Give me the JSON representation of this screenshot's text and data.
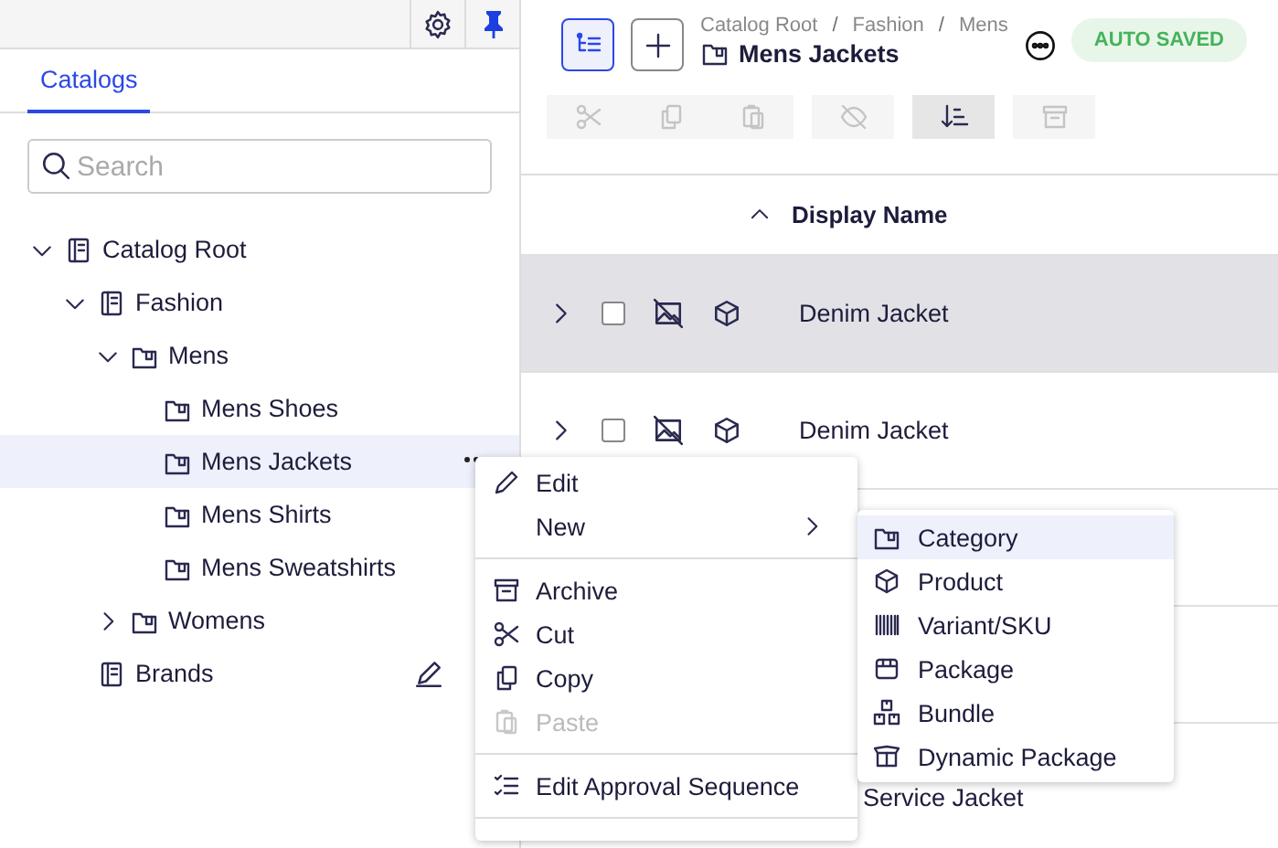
{
  "sidebar": {
    "tabs": [
      {
        "label": "Catalogs",
        "selected": true
      }
    ],
    "search": {
      "placeholder": "Search"
    },
    "tree": [
      {
        "label": "Catalog Root",
        "kind": "catalog",
        "expanded": true,
        "selected": false,
        "children": [
          {
            "label": "Fashion",
            "kind": "catalog",
            "expanded": true,
            "selected": false,
            "children": [
              {
                "label": "Mens",
                "kind": "category",
                "expanded": true,
                "selected": false,
                "children": [
                  {
                    "label": "Mens Shoes",
                    "kind": "category",
                    "selected": false
                  },
                  {
                    "label": "Mens Jackets",
                    "kind": "category",
                    "selected": true
                  },
                  {
                    "label": "Mens Shirts",
                    "kind": "category",
                    "selected": false
                  },
                  {
                    "label": "Mens Sweatshirts",
                    "kind": "category",
                    "selected": false
                  }
                ]
              },
              {
                "label": "Womens",
                "kind": "category",
                "expanded": false,
                "selected": false
              }
            ]
          },
          {
            "label": "Brands",
            "kind": "catalog",
            "selected": false,
            "editable": true
          }
        ]
      }
    ]
  },
  "header": {
    "buttons": [
      {
        "kind": "tree-view",
        "selected": true
      },
      {
        "kind": "add",
        "selected": false
      }
    ],
    "breadcrumb": [
      {
        "kind": "link",
        "label": "Catalog Root"
      },
      {
        "kind": "separator",
        "label": "/"
      },
      {
        "kind": "link",
        "label": "Fashion"
      },
      {
        "kind": "separator",
        "label": "/"
      },
      {
        "kind": "link",
        "label": "Mens"
      }
    ],
    "title": "Mens Jackets",
    "status": "AUTO SAVED"
  },
  "toolbar": [
    [
      {
        "kind": "cut",
        "disabled": true,
        "active": false
      },
      {
        "kind": "copy",
        "disabled": true,
        "active": false
      },
      {
        "kind": "paste",
        "disabled": true,
        "active": false
      }
    ],
    [
      {
        "kind": "hide",
        "disabled": true,
        "active": false
      }
    ],
    [
      {
        "kind": "sort",
        "disabled": false,
        "active": true
      }
    ],
    [
      {
        "kind": "archive",
        "disabled": true,
        "active": false
      }
    ]
  ],
  "table": {
    "columns": [
      {
        "label": "Display Name"
      }
    ],
    "rows": [
      {
        "kind": "parent",
        "name": "Denim Jacket",
        "expanded": false,
        "checked": false,
        "highlighted": true
      },
      {
        "kind": "parent",
        "name": "Denim Jacket",
        "expanded": false,
        "checked": false,
        "highlighted": false
      },
      {
        "kind": "child",
        "name": "Service Jacket",
        "highlighted": false
      }
    ]
  },
  "context_menu": {
    "items": [
      {
        "kind": "edit",
        "label": "Edit",
        "disabled": false
      },
      {
        "kind": "new",
        "label": "New",
        "disabled": false,
        "submenu": true
      },
      {
        "kind": "divider"
      },
      {
        "kind": "archive",
        "label": "Archive",
        "disabled": false
      },
      {
        "kind": "cut",
        "label": "Cut",
        "disabled": false
      },
      {
        "kind": "copy",
        "label": "Copy",
        "disabled": false
      },
      {
        "kind": "paste",
        "label": "Paste",
        "disabled": true
      },
      {
        "kind": "divider"
      },
      {
        "kind": "approval",
        "label": "Edit Approval Sequence",
        "disabled": false
      },
      {
        "kind": "divider"
      }
    ]
  },
  "submenu": {
    "items": [
      {
        "kind": "category",
        "label": "Category",
        "highlighted": true
      },
      {
        "kind": "product",
        "label": "Product",
        "highlighted": false
      },
      {
        "kind": "variant",
        "label": "Variant/SKU",
        "highlighted": false
      },
      {
        "kind": "package",
        "label": "Package",
        "highlighted": false
      },
      {
        "kind": "bundle",
        "label": "Bundle",
        "highlighted": false
      },
      {
        "kind": "dynamic",
        "label": "Dynamic Package",
        "highlighted": false
      }
    ]
  }
}
